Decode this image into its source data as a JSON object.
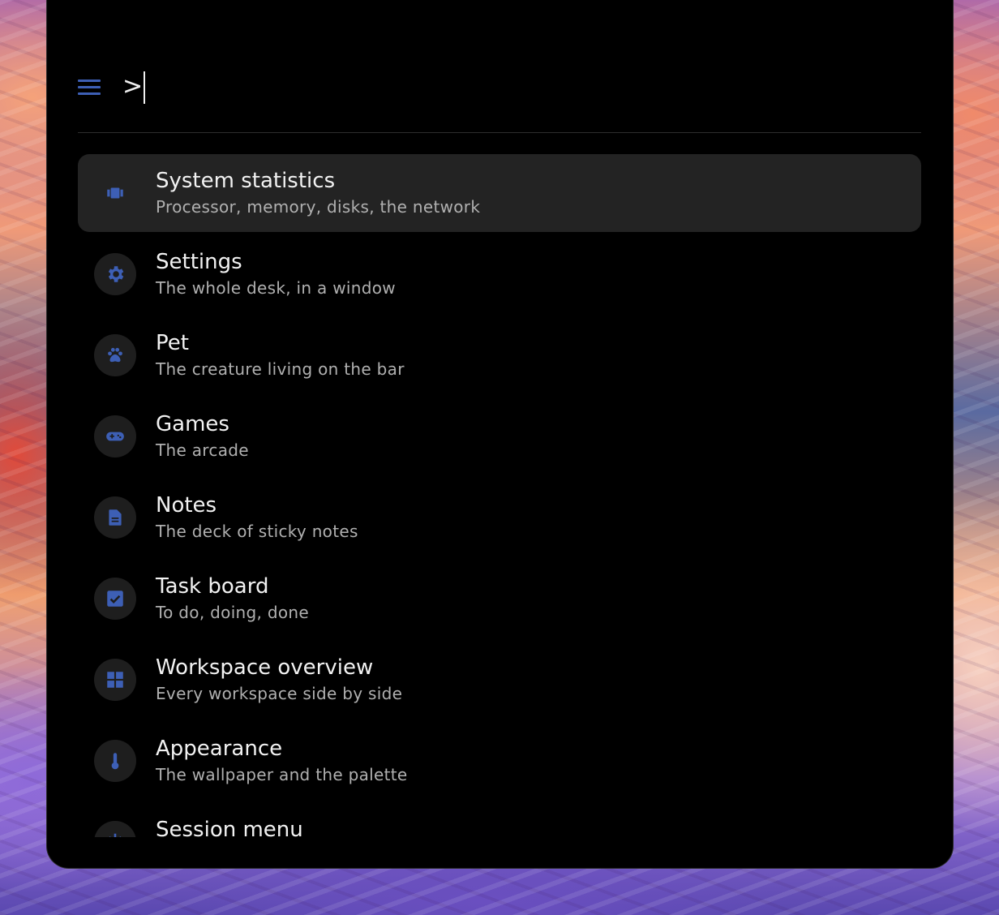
{
  "search": {
    "prompt": ">"
  },
  "accent_color": "#3d5fb5",
  "items": [
    {
      "title": "System statistics",
      "subtitle": "Processor, memory, disks, the network",
      "icon": "chip-icon",
      "selected": true
    },
    {
      "title": "Settings",
      "subtitle": "The whole desk, in a window",
      "icon": "gear-icon"
    },
    {
      "title": "Pet",
      "subtitle": "The creature living on the bar",
      "icon": "paw-icon"
    },
    {
      "title": "Games",
      "subtitle": "The arcade",
      "icon": "gamepad-icon"
    },
    {
      "title": "Notes",
      "subtitle": "The deck of sticky notes",
      "icon": "note-icon"
    },
    {
      "title": "Task board",
      "subtitle": "To do, doing, done",
      "icon": "checkbox-icon"
    },
    {
      "title": "Workspace overview",
      "subtitle": "Every workspace side by side",
      "icon": "grid-icon"
    },
    {
      "title": "Appearance",
      "subtitle": "The wallpaper and the palette",
      "icon": "thermometer-icon"
    },
    {
      "title": "Session menu",
      "subtitle": "",
      "icon": "power-icon"
    }
  ]
}
